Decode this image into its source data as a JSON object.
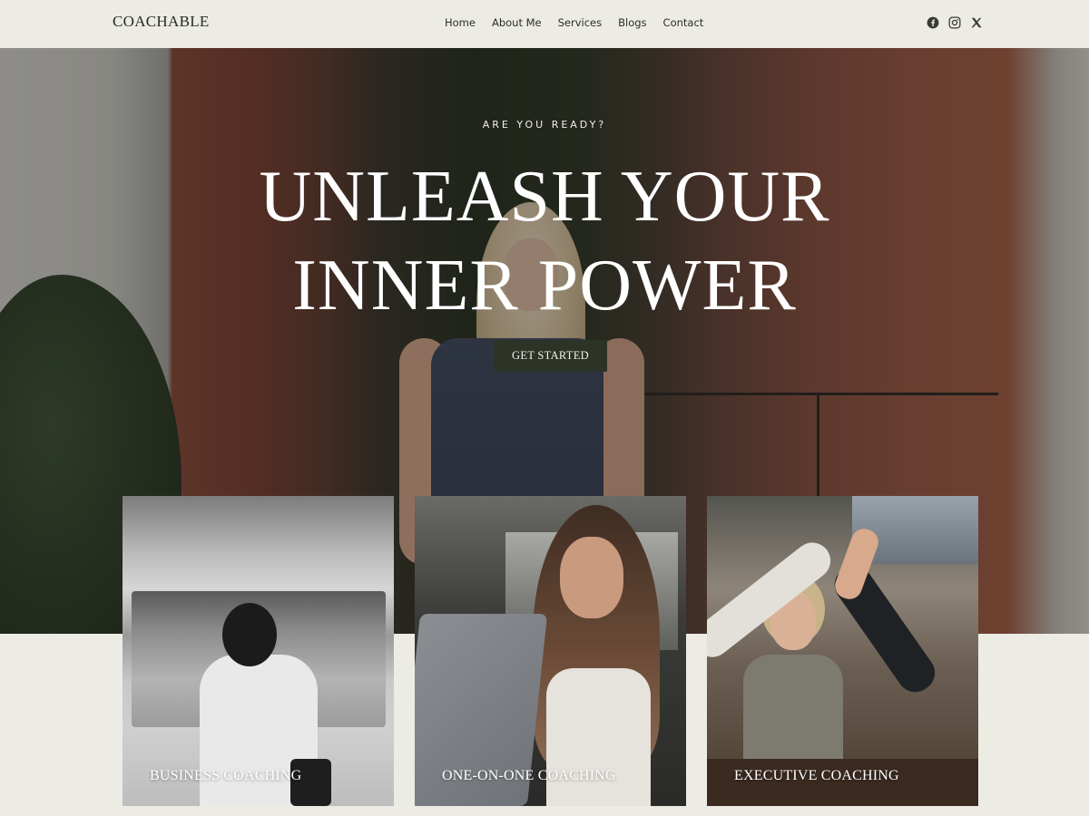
{
  "header": {
    "logo": "COACHABLE",
    "nav": [
      "Home",
      "About Me",
      "Services",
      "Blogs",
      "Contact"
    ],
    "social": [
      "facebook-icon",
      "instagram-icon",
      "x-icon"
    ]
  },
  "hero": {
    "eyebrow": "ARE YOU READY?",
    "headline_line1": "UNLEASH YOUR",
    "headline_line2": "INNER POWER",
    "cta": "GET STARTED"
  },
  "cards": [
    {
      "label": "BUSINESS COACHING"
    },
    {
      "label": "ONE-ON-ONE COACHING"
    },
    {
      "label": "EXECUTIVE COACHING"
    }
  ],
  "colors": {
    "page_bg": "#ecebe4",
    "cta_bg": "#2d3327",
    "text_dark": "#2d2d2a"
  }
}
